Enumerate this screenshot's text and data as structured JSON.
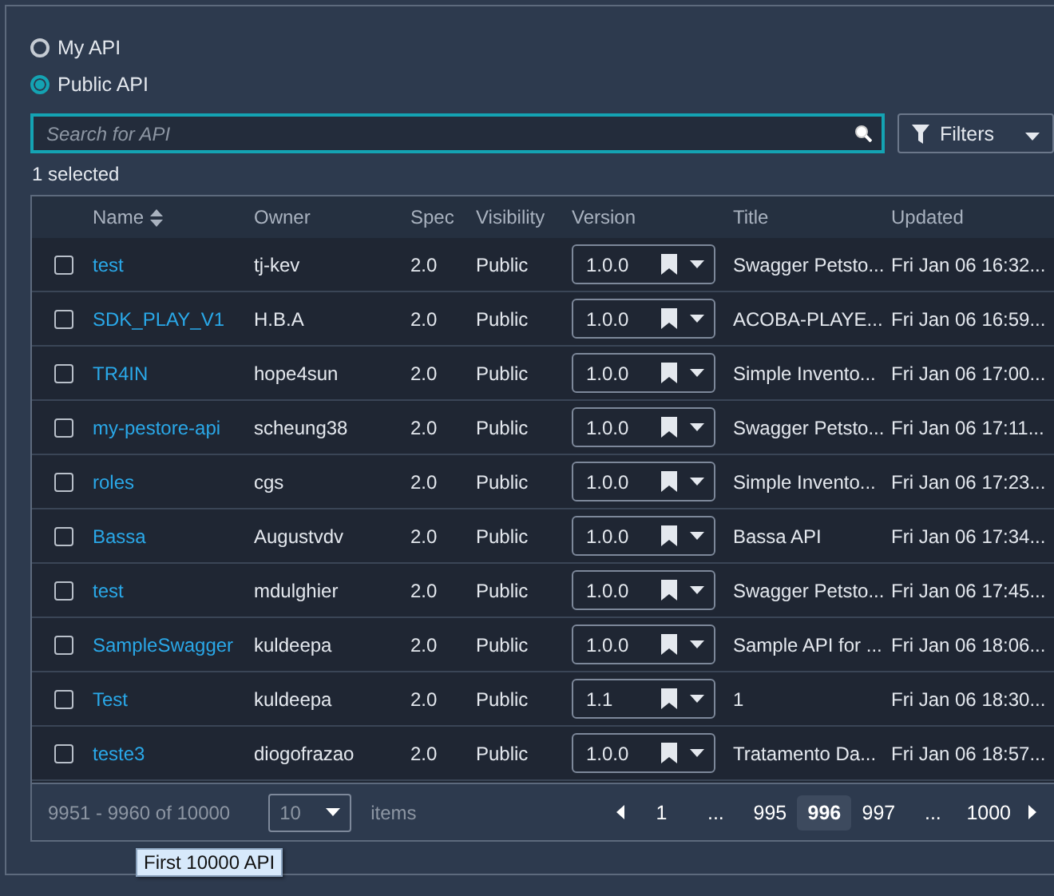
{
  "scope": [
    {
      "label": "My API",
      "selected": false
    },
    {
      "label": "Public API",
      "selected": true
    }
  ],
  "search": {
    "placeholder": "Search for API"
  },
  "filters_button": "Filters",
  "selection_count": "1 selected",
  "table": {
    "columns": [
      "Name",
      "Owner",
      "Spec",
      "Visibility",
      "Version",
      "Title",
      "Updated"
    ],
    "rows": [
      {
        "checked": false,
        "name": "test",
        "owner": "tj-kev",
        "spec": "2.0",
        "visibility": "Public",
        "version": "1.0.0",
        "title": "Swagger Petsto...",
        "updated": "Fri Jan 06 16:32..."
      },
      {
        "checked": false,
        "name": "SDK_PLAY_V1",
        "owner": "H.B.A",
        "spec": "2.0",
        "visibility": "Public",
        "version": "1.0.0",
        "title": "ACOBA-PLAYE...",
        "updated": "Fri Jan 06 16:59..."
      },
      {
        "checked": false,
        "name": "TR4IN",
        "owner": "hope4sun",
        "spec": "2.0",
        "visibility": "Public",
        "version": "1.0.0",
        "title": "Simple Invento...",
        "updated": "Fri Jan 06 17:00..."
      },
      {
        "checked": false,
        "name": "my-pestore-api",
        "owner": "scheung38",
        "spec": "2.0",
        "visibility": "Public",
        "version": "1.0.0",
        "title": "Swagger Petsto...",
        "updated": "Fri Jan 06 17:11..."
      },
      {
        "checked": false,
        "name": "roles",
        "owner": "cgs",
        "spec": "2.0",
        "visibility": "Public",
        "version": "1.0.0",
        "title": "Simple Invento...",
        "updated": "Fri Jan 06 17:23..."
      },
      {
        "checked": false,
        "name": "Bassa",
        "owner": "Augustvdv",
        "spec": "2.0",
        "visibility": "Public",
        "version": "1.0.0",
        "title": "Bassa API",
        "updated": "Fri Jan 06 17:34..."
      },
      {
        "checked": false,
        "name": "test",
        "owner": "mdulghier",
        "spec": "2.0",
        "visibility": "Public",
        "version": "1.0.0",
        "title": "Swagger Petsto...",
        "updated": "Fri Jan 06 17:45..."
      },
      {
        "checked": false,
        "name": "SampleSwagger",
        "owner": "kuldeepa",
        "spec": "2.0",
        "visibility": "Public",
        "version": "1.0.0",
        "title": "Sample API for ...",
        "updated": "Fri Jan 06 18:06..."
      },
      {
        "checked": false,
        "name": "Test",
        "owner": "kuldeepa",
        "spec": "2.0",
        "visibility": "Public",
        "version": "1.1",
        "title": "1",
        "updated": "Fri Jan 06 18:30..."
      },
      {
        "checked": false,
        "name": "teste3",
        "owner": "diogofrazao",
        "spec": "2.0",
        "visibility": "Public",
        "version": "1.0.0",
        "title": "Tratamento Da...",
        "updated": "Fri Jan 06 18:57..."
      }
    ]
  },
  "pager": {
    "range": "9951 - 9960 of 10000",
    "page_size": "10",
    "items_label": "items",
    "pages": [
      {
        "label": "1",
        "selected": false
      },
      {
        "label": "...",
        "selected": false
      },
      {
        "label": "995",
        "selected": false
      },
      {
        "label": "996",
        "selected": true
      },
      {
        "label": "997",
        "selected": false
      },
      {
        "label": "...",
        "selected": false
      },
      {
        "label": "1000",
        "selected": false
      }
    ]
  },
  "tooltip": "First 10000 API"
}
